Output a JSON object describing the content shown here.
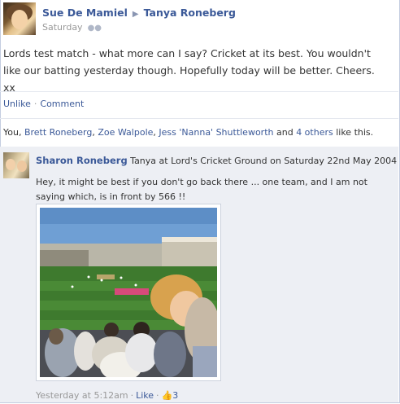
{
  "post": {
    "author": "Sue De Mamiel",
    "target": "Tanya Roneberg",
    "time": "Saturday",
    "body": "Lords test match - what more can I say? Cricket at its best. You wouldn't like our batting yesterday though. Hopefully today will be better. Cheers. xx",
    "actions": {
      "unlike": "Unlike",
      "comment": "Comment"
    }
  },
  "likes": {
    "prefix": "You, ",
    "people": [
      "Brett Roneberg",
      "Zoe Walpole",
      "Jess 'Nanna' Shuttleworth"
    ],
    "and": " and ",
    "others": "4 others",
    "suffix": " like this."
  },
  "comment": {
    "author": "Sharon Roneberg",
    "caption": "Tanya at Lord's Cricket Ground on Saturday 22nd May 2004",
    "text": "Hey, it might be best if you don't go back there ... one team, and I am not saying which, is in front by 566 !!",
    "time": "Yesterday at 5:12am",
    "like": "Like",
    "like_count": "3"
  },
  "icons": [
    "people-icon",
    "arrow-icon",
    "thumbs-up-icon"
  ],
  "colors": {
    "link": "#3b5998",
    "comment_bg": "#edeff4"
  }
}
